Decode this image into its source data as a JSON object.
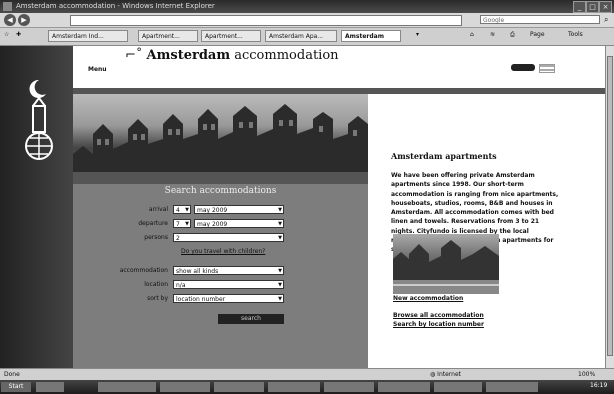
{
  "window": {
    "title": "Amsterdam accommodation - Windows Internet Explorer"
  },
  "browser": {
    "search_placeholder": "Google",
    "tabs": [
      {
        "label": "Amsterdam Ind..."
      },
      {
        "label": "Apartment..."
      },
      {
        "label": "Apartment..."
      },
      {
        "label": "Amsterdam Apa..."
      },
      {
        "label": "Amsterdam"
      }
    ],
    "page_menu": "Page",
    "tools_menu": "Tools"
  },
  "page": {
    "site_title_prefix": "Amsterdam",
    "site_title_suffix": "accommodation",
    "menu_label": "Menu",
    "search": {
      "heading": "Search accommodations",
      "arrival_label": "arrival",
      "arrival_day": "4",
      "arrival_month": "may 2009",
      "departure_label": "departure",
      "departure_day": "7",
      "departure_month": "may 2009",
      "persons_label": "persons",
      "persons_value": "2",
      "children_link": "Do you travel with children?",
      "accommodation_label": "accommodation",
      "accommodation_value": "show all kinds",
      "location_label": "location",
      "location_value": "n/a",
      "sort_label": "sort by",
      "sort_value": "location number",
      "search_button": "search"
    },
    "sidebar": {
      "heading": "Amsterdam apartments",
      "text": "We have been offering private Amsterdam apartments since 1998. Our short-term accommodation is ranging from nice apartments, houseboats, studios, rooms, B&B and houses in Amsterdam. All accommodation comes with bed linen and towels. Reservations from 3 to 21 nights. Cityfundo is licensed by the local municipality to offer amsterdam apartments for short-term rental.",
      "new_accommodation": "New accommodation",
      "browse_all": "Browse all accommodation",
      "search_location": "Search by location number"
    }
  },
  "status": {
    "text": "Done",
    "zone": "Internet",
    "zoom": "100%"
  },
  "taskbar": {
    "start": "Start",
    "clock": "16:19"
  }
}
